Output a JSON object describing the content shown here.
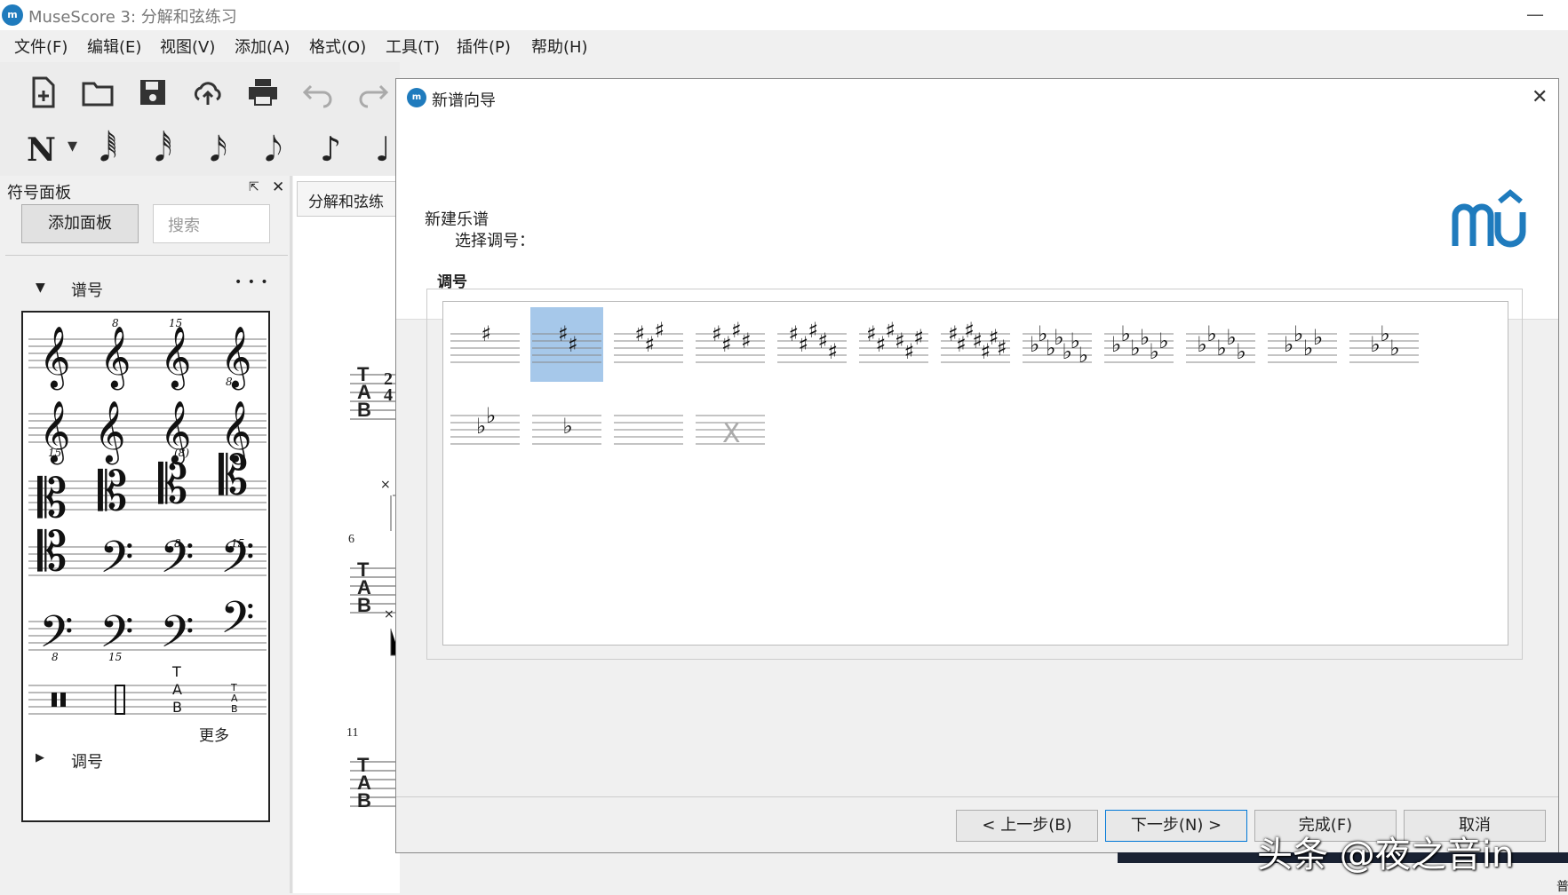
{
  "window": {
    "title": "MuseScore 3: 分解和弦练习",
    "minimize_glyph": "—"
  },
  "menu": [
    "文件(F)",
    "编辑(E)",
    "视图(V)",
    "添加(A)",
    "格式(O)",
    "工具(T)",
    "插件(P)",
    "帮助(H)"
  ],
  "toolbar": {
    "buttons": [
      "new-file-icon",
      "open-folder-icon",
      "save-icon",
      "cloud-upload-icon",
      "print-icon",
      "undo-icon",
      "redo-icon"
    ],
    "note_input": "N",
    "dropdown_glyph": "▾"
  },
  "palette": {
    "title": "符号面板",
    "add_button": "添加面板",
    "search_placeholder": "搜索",
    "section_clefs": "谱号",
    "section_clefs_menu": "• • •",
    "more_label": "更多",
    "section_keysig": "调号",
    "expanded_glyph": "▼",
    "collapsed_glyph": "▶",
    "float_glyph": "⇱",
    "close_glyph": "✕"
  },
  "score": {
    "tab_label": "分解和弦练",
    "tab_letters": [
      "T",
      "A",
      "B"
    ],
    "time_sig_top": "2",
    "time_sig_bottom": "4",
    "measure_numbers": [
      "6",
      "11"
    ],
    "x_mark": "×"
  },
  "dialog": {
    "title": "新谱向导",
    "close_glyph": "✕",
    "heading": "新建乐谱",
    "subheading": "选择调号：",
    "group_label": "调号",
    "selected_index": 1,
    "accent": "#a6c8ea",
    "logo_color": "#1f7bbd",
    "key_signatures": [
      {
        "type": "sharp",
        "count": 1
      },
      {
        "type": "sharp",
        "count": 2
      },
      {
        "type": "sharp",
        "count": 3
      },
      {
        "type": "sharp",
        "count": 4
      },
      {
        "type": "sharp",
        "count": 5
      },
      {
        "type": "sharp",
        "count": 6
      },
      {
        "type": "sharp",
        "count": 7
      },
      {
        "type": "flat",
        "count": 7
      },
      {
        "type": "flat",
        "count": 6
      },
      {
        "type": "flat",
        "count": 5
      },
      {
        "type": "flat",
        "count": 4
      },
      {
        "type": "flat",
        "count": 3
      },
      {
        "type": "flat",
        "count": 2
      },
      {
        "type": "flat",
        "count": 1
      },
      {
        "type": "none",
        "count": 0
      },
      {
        "type": "atonal",
        "count": 0
      }
    ],
    "buttons": {
      "back": "< 上一步(B)",
      "next": "下一步(N) >",
      "finish": "完成(F)",
      "cancel": "取消"
    }
  },
  "watermark": "头条 @夜之音in",
  "status_right": "普"
}
